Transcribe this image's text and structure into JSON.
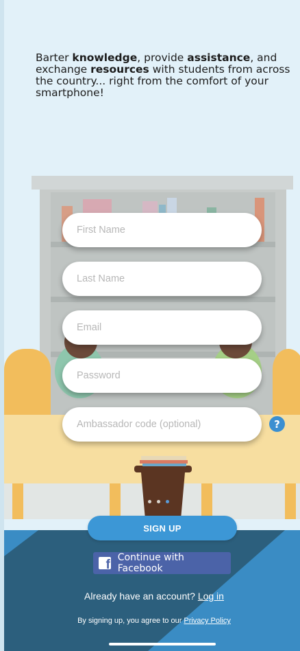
{
  "tagline": {
    "part1": "Barter ",
    "bold1": "knowledge",
    "part2": ", provide ",
    "bold2": "assistance",
    "part3": ", and exchange ",
    "bold3": "resources",
    "part4": " with students from across the country... right from the comfort of your smartphone!"
  },
  "form": {
    "first_name_placeholder": "First Name",
    "last_name_placeholder": "Last Name",
    "email_placeholder": "Email",
    "password_placeholder": "Password",
    "ambassador_placeholder": "Ambassador code (optional)",
    "help_label": "?"
  },
  "pager": {
    "count": 3,
    "active_index": 2
  },
  "actions": {
    "signup_label": "SIGN UP",
    "facebook_label": "Continue with Facebook",
    "have_account_text": "Already have an account? ",
    "login_link": "Log in",
    "terms_text": "By signing up, you agree to our ",
    "privacy_link": "Privacy Policy"
  },
  "colors": {
    "background": "#e2f1f9",
    "accent_blue": "#3c97d6",
    "facebook_blue": "#4b63a8",
    "dark_navy": "#2c5f7d"
  },
  "icons": {
    "facebook": "facebook-logo-icon",
    "help": "question-circle-icon"
  }
}
